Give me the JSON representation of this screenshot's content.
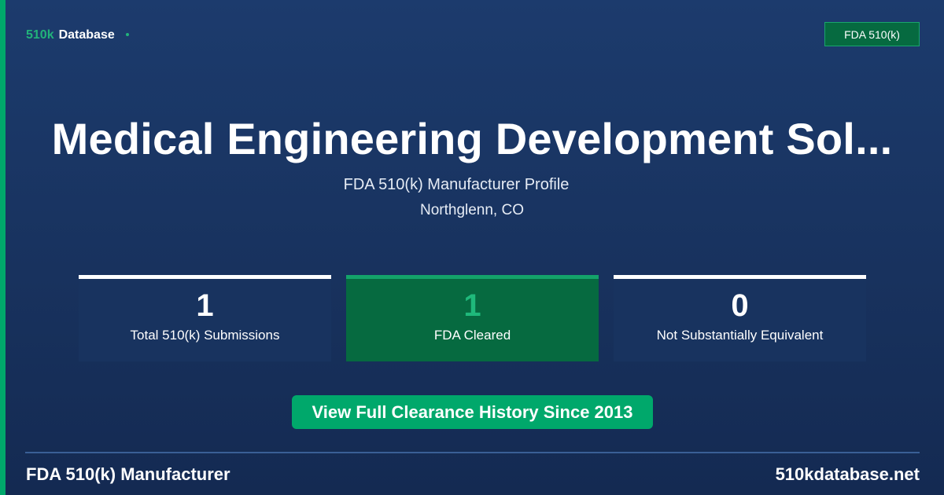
{
  "brand": {
    "part1": "510k",
    "part2": "Database"
  },
  "badge": {
    "label": "FDA 510(k)"
  },
  "header": {
    "title": "Medical Engineering Development Sol...",
    "subtitle": "FDA 510(k) Manufacturer Profile",
    "location": "Northglenn, CO"
  },
  "stats": [
    {
      "value": "1",
      "label": "Total 510(k) Submissions"
    },
    {
      "value": "1",
      "label": "FDA Cleared"
    },
    {
      "value": "0",
      "label": "Not Substantially Equivalent"
    }
  ],
  "cta": {
    "label": "View Full Clearance History Since 2013"
  },
  "footer": {
    "left": "FDA 510(k) Manufacturer",
    "right": "510kdatabase.net"
  },
  "colors": {
    "accent": "#00a86b",
    "background": "#1c3b6d",
    "cleared": "#066a40"
  }
}
